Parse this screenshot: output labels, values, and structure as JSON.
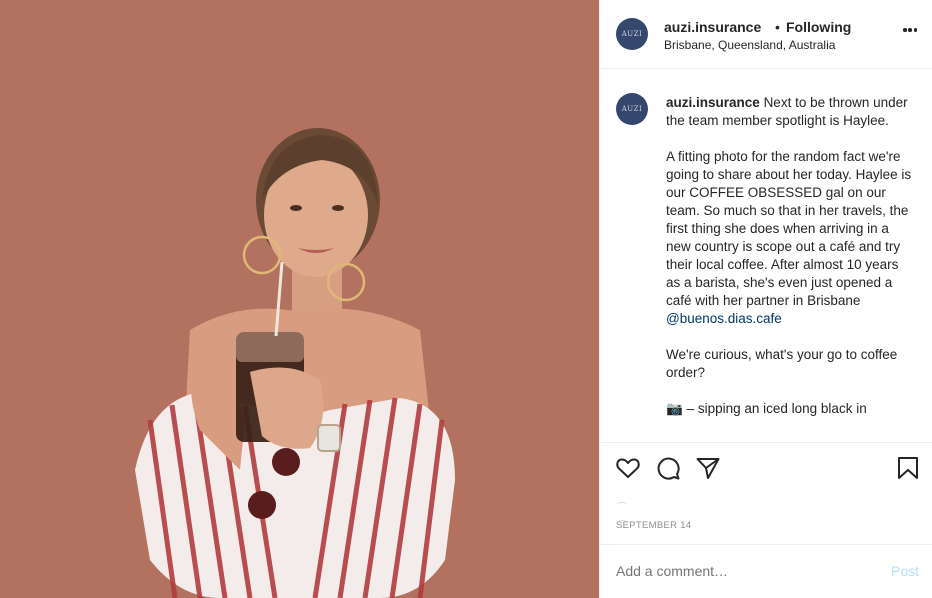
{
  "header": {
    "username": "auzi.insurance",
    "separator": "•",
    "follow_status": "Following",
    "location": "Brisbane, Queensland, Australia",
    "avatar_text": "AUZI",
    "more_icon": "more-horizontal-icon"
  },
  "caption": {
    "username": "auzi.insurance",
    "intro": "Next to be thrown under the team member spotlight is Haylee.",
    "paragraph2": "A fitting photo for the random fact we're going to share about her today. Haylee is our COFFEE OBSESSED gal on our team. So much so that in her travels, the first thing she does when arriving in a new country is scope out a café and try their local coffee. After almost 10 years as a barista, she's even just opened a café with her partner in Brisbane",
    "mention": "@buenos.dias.cafe",
    "paragraph3": "We're curious, what's your go to coffee order?",
    "camera_emoji": "📷",
    "paragraph4": "– sipping an iced long black in"
  },
  "actions": {
    "like_icon": "heart-icon",
    "comment_icon": "comment-icon",
    "share_icon": "share-icon",
    "save_icon": "bookmark-icon"
  },
  "date": "SEPTEMBER 14",
  "comment": {
    "placeholder": "Add a comment…",
    "post_label": "Post"
  },
  "colors": {
    "photo_background": "#b2725f",
    "avatar": "#36476d",
    "mention": "#00376b",
    "post_disabled": "#b2dffc"
  }
}
